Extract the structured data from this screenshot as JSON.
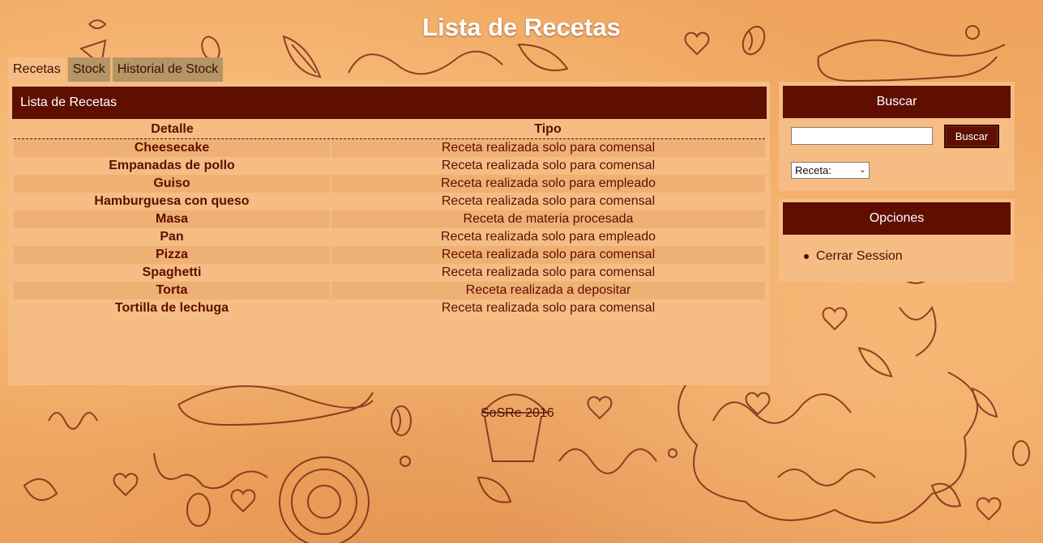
{
  "page": {
    "title": "Lista de Recetas"
  },
  "tabs": [
    {
      "label": "Recetas",
      "active": true
    },
    {
      "label": "Stock",
      "active": false
    },
    {
      "label": "Historial de Stock",
      "active": false
    }
  ],
  "main": {
    "header": "Lista de Recetas",
    "columns": [
      "Detalle",
      "Tipo"
    ],
    "rows": [
      {
        "detalle": "Cheesecake",
        "tipo": "Receta realizada solo para comensal"
      },
      {
        "detalle": "Empanadas de pollo",
        "tipo": "Receta realizada solo para comensal"
      },
      {
        "detalle": "Guiso",
        "tipo": "Receta realizada solo para empleado"
      },
      {
        "detalle": "Hamburguesa con queso",
        "tipo": "Receta realizada solo para comensal"
      },
      {
        "detalle": "Masa",
        "tipo": "Receta de materia procesada"
      },
      {
        "detalle": "Pan",
        "tipo": "Receta realizada solo para empleado"
      },
      {
        "detalle": "Pizza",
        "tipo": "Receta realizada solo para comensal"
      },
      {
        "detalle": "Spaghetti",
        "tipo": "Receta realizada solo para comensal"
      },
      {
        "detalle": "Torta",
        "tipo": "Receta realizada a depositar"
      },
      {
        "detalle": "Tortilla de lechuga",
        "tipo": "Receta realizada solo para comensal"
      }
    ]
  },
  "search": {
    "header": "Buscar",
    "input_value": "",
    "button_label": "Buscar",
    "select_value": "Receta:"
  },
  "options": {
    "header": "Opciones",
    "items": [
      "Cerrar Session"
    ]
  },
  "footer": {
    "text": "SoSRe 2016"
  },
  "colors": {
    "header_bg": "#5e0f00",
    "panel_bg": "#f5bd84",
    "background": "#f0a862"
  }
}
